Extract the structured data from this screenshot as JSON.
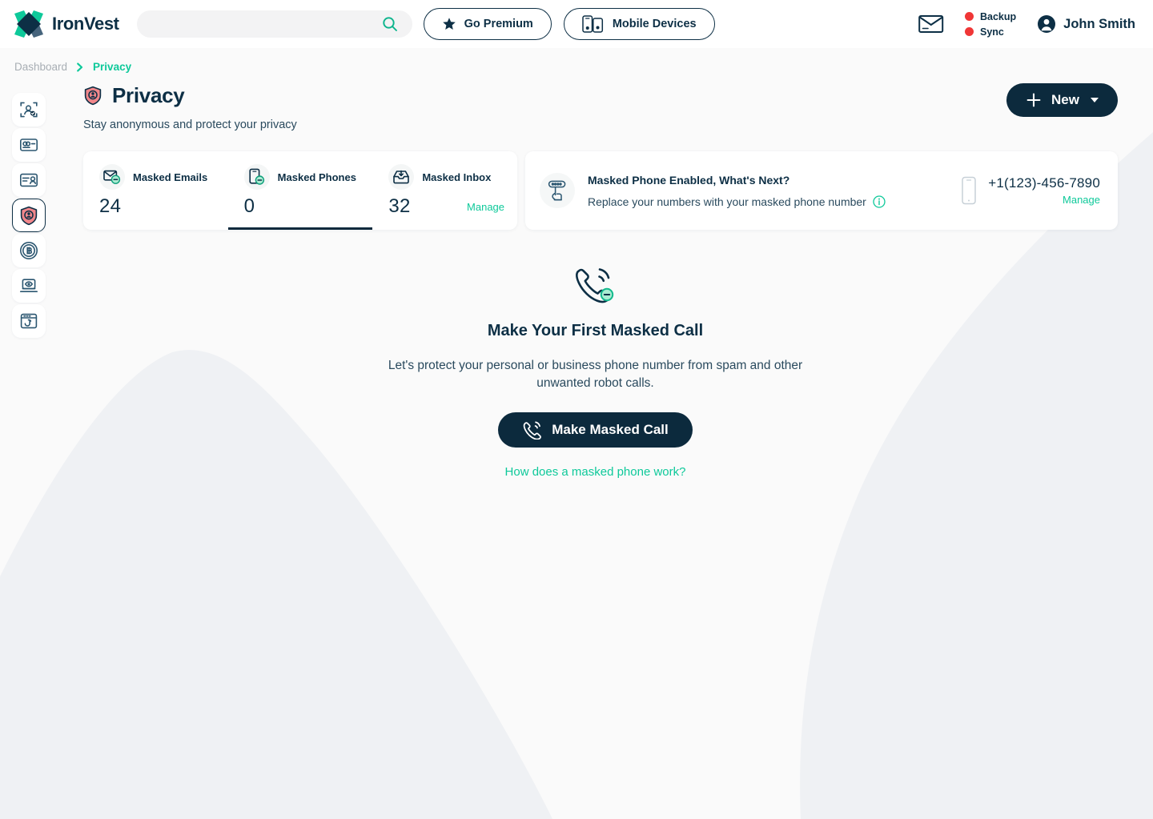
{
  "brand": {
    "name": "IronVest",
    "logo_icon": "ironvest-diamond-logo",
    "teal": "#0ec99a",
    "navy": "#0d2f45",
    "red": "#f03636",
    "salmon": "#f0868a"
  },
  "header": {
    "search": {
      "value": "",
      "placeholder": "",
      "icon": "search-icon"
    },
    "go_premium": {
      "label": "Go Premium",
      "icon": "star-icon"
    },
    "mobile_devices": {
      "label": "Mobile Devices",
      "icon": "mobile-devices-icon"
    },
    "mail_icon": "envelope-icon",
    "statuses": [
      {
        "label": "Backup",
        "color": "#f03636"
      },
      {
        "label": "Sync",
        "color": "#f03636"
      }
    ],
    "user": {
      "name": "John Smith",
      "icon": "avatar-icon"
    }
  },
  "breadcrumb": {
    "items": [
      {
        "label": "Dashboard",
        "active": false
      },
      {
        "label": "Privacy",
        "active": true
      }
    ],
    "separator_icon": "chevron-right-icon"
  },
  "sidebar": {
    "items": [
      {
        "name": "identity-scan",
        "icon": "identity-scan-icon",
        "active": false
      },
      {
        "name": "payment-card",
        "icon": "credit-card-icon",
        "active": false
      },
      {
        "name": "id-card",
        "icon": "id-card-icon",
        "active": false
      },
      {
        "name": "privacy",
        "icon": "privacy-shield-icon",
        "active": true
      },
      {
        "name": "crypto",
        "icon": "bitcoin-icon",
        "active": false
      },
      {
        "name": "browser-privacy",
        "icon": "laptop-eye-icon",
        "active": false
      },
      {
        "name": "anti-phishing",
        "icon": "phishing-hook-icon",
        "active": false
      }
    ]
  },
  "page": {
    "title": "Privacy",
    "title_icon": "privacy-shield-icon",
    "subtitle": "Stay anonymous and protect your privacy",
    "new_button": {
      "label": "New",
      "icon": "plus-icon",
      "caret": "chevron-down-icon"
    }
  },
  "stats": {
    "items": [
      {
        "label": "Masked Emails",
        "value": "24",
        "icon": "masked-email-icon",
        "active": false
      },
      {
        "label": "Masked Phones",
        "value": "0",
        "icon": "masked-phone-icon",
        "active": true
      },
      {
        "label": "Masked Inbox",
        "value": "32",
        "icon": "masked-inbox-icon",
        "active": false
      }
    ],
    "manage_label": "Manage"
  },
  "promo": {
    "icon": "hand-click-icon",
    "title": "Masked Phone Enabled, What's Next?",
    "subtitle": "Replace your numbers with your masked phone number",
    "info_icon": "info-circle-icon",
    "phone_icon": "phone-outline-icon",
    "phone_number": "+1(123)-456-7890",
    "manage_label": "Manage"
  },
  "empty_state": {
    "icon": "phone-call-badge-icon",
    "title": "Make Your First Masked Call",
    "description": "Let's protect your personal or business phone number from spam and other unwanted robot calls.",
    "cta": {
      "label": "Make Masked Call",
      "icon": "phone-call-icon"
    },
    "help_link": "How does a masked phone work?"
  }
}
